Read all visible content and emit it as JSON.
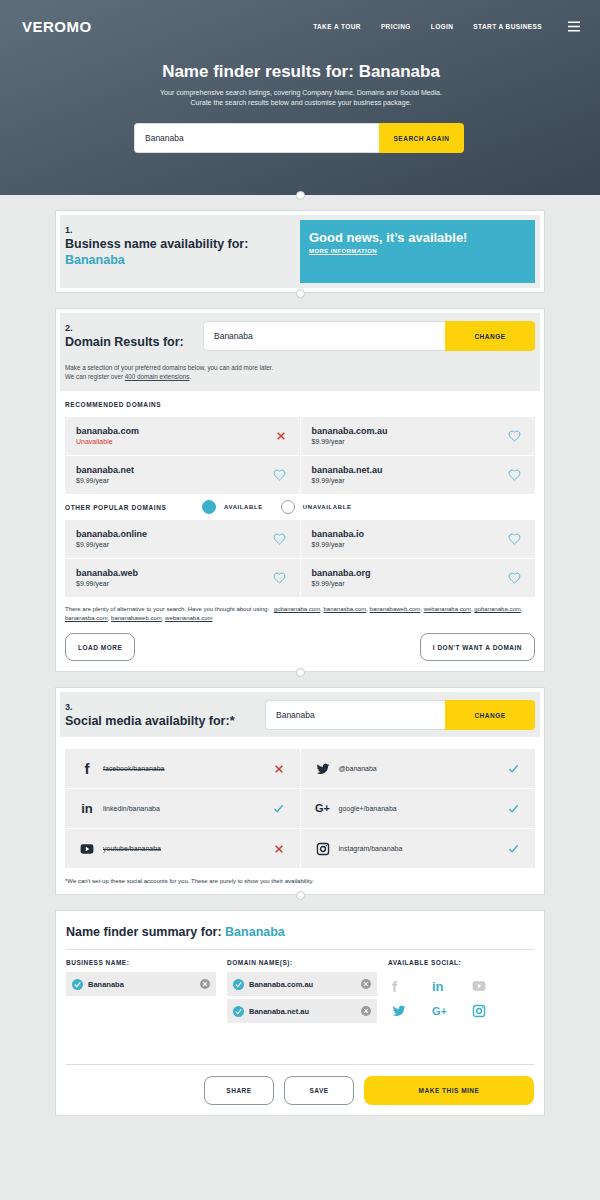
{
  "header": {
    "logo": "VEROMO",
    "nav": [
      {
        "label": "TAKE A TOUR"
      },
      {
        "label": "PRICING"
      },
      {
        "label": "LOGIN"
      },
      {
        "label": "START A BUSINESS"
      }
    ]
  },
  "hero": {
    "title": "Name finder results for:",
    "name": "Bananaba",
    "subtitle": [
      "Your comprehensive search listings, covering Company Name, Domains and Social Media.",
      "Curate the search results below and customise your business package."
    ],
    "search": {
      "value": "Bananaba",
      "button": "SEARCH AGAIN"
    }
  },
  "business": {
    "number": "1.",
    "title": "Business name availability for:",
    "name": "Bananaba",
    "available": true,
    "message": "Good news, it’s available!",
    "link": "MORE INFORMATION"
  },
  "domains": {
    "number": "2.",
    "title": "Domain Results for:",
    "value": "Bananaba",
    "button": "CHANGE",
    "note": "Make a selection of your preferred domains below, you can add more later.",
    "note2_before": "We can register over ",
    "note2_link": "400 domain extensions",
    "note2_after": ".",
    "recommended_heading": "RECOMMENDED DOMAINS",
    "recommended": [
      {
        "name": "bananaba.com",
        "detail": "Unavailable",
        "available": false
      },
      {
        "name": "bananaba.com.au",
        "detail": "$9.99/year",
        "available": true
      },
      {
        "name": "bananaba.net",
        "detail": "$9.99/year",
        "available": true
      },
      {
        "name": "bananaba.net.au",
        "detail": "$9.99/year",
        "available": true
      }
    ],
    "other_heading": "OTHER POPULAR DOMAINS",
    "legend": [
      {
        "label": "AVAILABLE",
        "selected": true
      },
      {
        "label": "UNAVAILABLE",
        "selected": false
      }
    ],
    "other": [
      {
        "name": "bananaba.online",
        "detail": "$9.99/year",
        "available": true
      },
      {
        "name": "bananaba.io",
        "detail": "$9.99/year",
        "available": true
      },
      {
        "name": "bananaba.web",
        "detail": "$9.99/year",
        "available": true
      },
      {
        "name": "bananaba.org",
        "detail": "$9.99/year",
        "available": true
      }
    ],
    "alternatives_prompt": "There are plenty of alternative to your search. Have you thought about using:",
    "alternatives_separator": ", ",
    "alternatives": [
      "gobananaba.com",
      "bananasba.com",
      "bananabaweb.com",
      "webananaba.com",
      "gobananaba.com",
      "bananasba.com",
      "bananabaweb.com",
      "webananaba.com"
    ],
    "load_more": "LOAD MORE",
    "no_domain": "I DON'T WANT A DOMAIN"
  },
  "social": {
    "number": "3.",
    "title": "Social media availabilty for:*",
    "value": "Bananaba",
    "button": "CHANGE",
    "items": [
      {
        "kind": "facebook",
        "glyph": "f",
        "handle": "facebook/bananaba",
        "available": false
      },
      {
        "kind": "twitter",
        "glyph": "",
        "handle": "@bananaba",
        "available": true
      },
      {
        "kind": "linkedin",
        "glyph": "in",
        "handle": "linkedin/bananaba",
        "available": true
      },
      {
        "kind": "google",
        "glyph": "G+",
        "handle": "google+/bananaba",
        "available": true
      },
      {
        "kind": "youtube",
        "glyph": "",
        "handle": "youtube/bananaba",
        "available": false
      },
      {
        "kind": "instagram",
        "glyph": "",
        "handle": "instagram/bananaba",
        "available": true
      }
    ],
    "note": "*We can't set-up these social accounts for you. These are purely to show you their availability."
  },
  "summary": {
    "title": "Name finder summary for:",
    "name": "Bananaba",
    "business_label": "BUSINESS NAME:",
    "business": [
      {
        "label": "Bananaba",
        "checked": true
      }
    ],
    "domain_label": "DOMAIN NAME(S):",
    "domains": [
      {
        "label": "Bananaba.com.au",
        "checked": true
      },
      {
        "label": "Bananaba.net.au",
        "checked": true
      }
    ],
    "social_label": "AVAILABLE SOCIAL:",
    "social": [
      {
        "kind": "facebook",
        "glyph": "f",
        "available": false
      },
      {
        "kind": "linkedin",
        "glyph": "in",
        "available": true
      },
      {
        "kind": "youtube",
        "glyph": "",
        "available": false
      },
      {
        "kind": "twitter",
        "glyph": "",
        "available": true
      },
      {
        "kind": "google",
        "glyph": "G+",
        "available": true
      },
      {
        "kind": "instagram",
        "glyph": "",
        "available": true
      }
    ],
    "share": "SHARE",
    "save": "SAVE",
    "make": "MAKE THIS MINE"
  }
}
